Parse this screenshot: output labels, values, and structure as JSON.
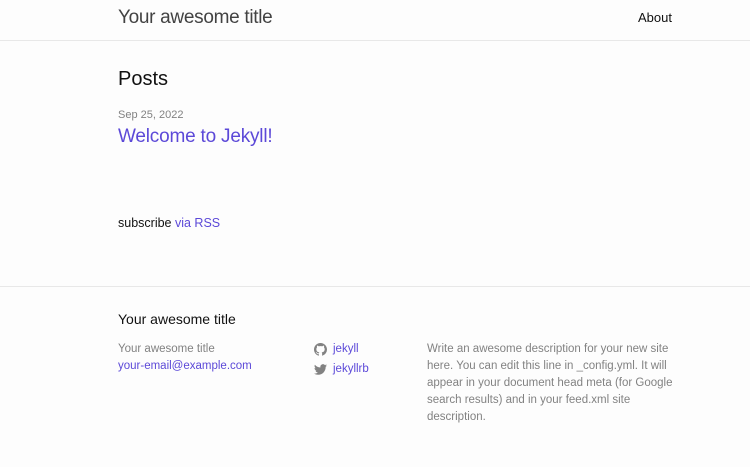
{
  "header": {
    "site_title": "Your awesome title",
    "nav": {
      "about_label": "About"
    }
  },
  "main": {
    "heading": "Posts",
    "posts": [
      {
        "date": "Sep 25, 2022",
        "title": "Welcome to Jekyll!"
      }
    ],
    "rss": {
      "prefix": "subscribe",
      "link_label": "via RSS"
    }
  },
  "footer": {
    "heading": "Your awesome title",
    "contact": {
      "name": "Your awesome title",
      "email": "your-email@example.com"
    },
    "social": [
      {
        "icon": "github-icon",
        "label": "jekyll"
      },
      {
        "icon": "twitter-icon",
        "label": "jekyllrb"
      }
    ],
    "description": "Write an awesome description for your new site here. You can edit this line in _config.yml. It will appear in your document head meta (for Google search results) and in your feed.xml site description."
  },
  "colors": {
    "link": "#5c49d8",
    "text": "#111111",
    "muted": "#828282",
    "border": "#e8e8e8",
    "background": "#fdfdfd"
  }
}
